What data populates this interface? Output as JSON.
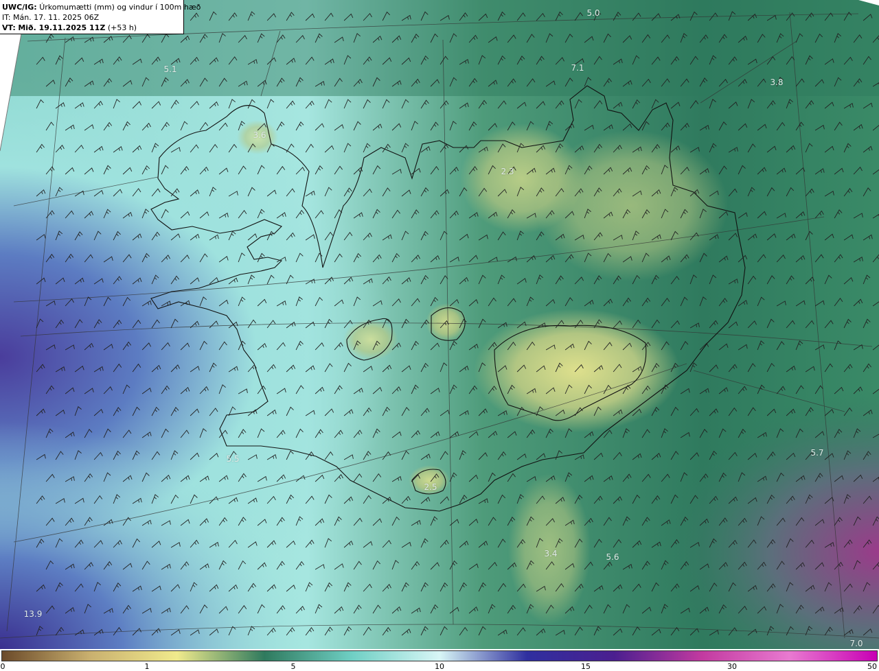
{
  "header": {
    "product": "UWC/IG:",
    "title": "Úrkomumætti (mm) og vindur í 100m hæð",
    "init_line": "IT: Mán. 17. 11. 2025 06Z",
    "valid_prefix": "VT:",
    "valid_time": "Mið. 19.11.2025 11Z",
    "lead": "(+53 h)"
  },
  "labels": [
    {
      "text": "5.0"
    },
    {
      "text": "5.1"
    },
    {
      "text": "7.1"
    },
    {
      "text": "3.8"
    },
    {
      "text": "3.6"
    },
    {
      "text": "2.3"
    },
    {
      "text": "5.7"
    },
    {
      "text": "2.5"
    },
    {
      "text": "3.4"
    },
    {
      "text": "5.6"
    },
    {
      "text": "13.9"
    },
    {
      "text": "7.0"
    },
    {
      "text": "5.5"
    }
  ],
  "colorbar": {
    "ticks": [
      "0",
      "1",
      "5",
      "10",
      "15",
      "30",
      "50"
    ],
    "colors": [
      "#6b4a2a",
      "#c9b06f",
      "#f0ea8c",
      "#2f7a5e",
      "#6fcfc4",
      "#d8f6f6",
      "#2f2f9f",
      "#4b1f8f",
      "#c23aa0",
      "#e87ad0",
      "#c800b4"
    ]
  }
}
